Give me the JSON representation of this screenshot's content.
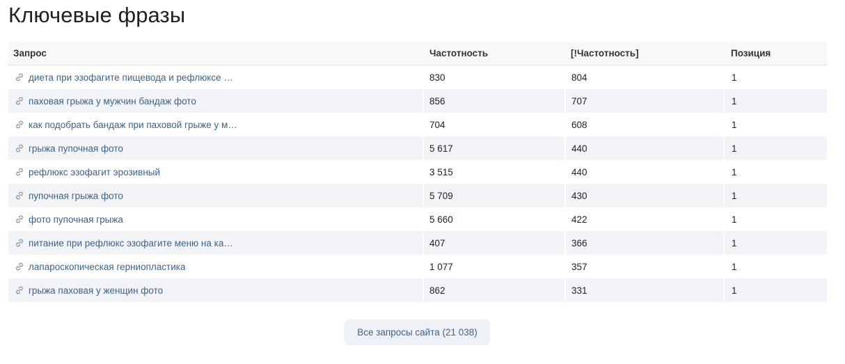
{
  "page": {
    "title": "Ключевые фразы"
  },
  "table": {
    "headers": {
      "query": "Запрос",
      "frequency": "Частотность",
      "exact_frequency": "[!Частотность]",
      "position": "Позиция"
    },
    "rows": [
      {
        "query": "диета при эзофагите пищевода и рефлюксе ре…",
        "frequency": "830",
        "exact_frequency": "804",
        "position": "1"
      },
      {
        "query": "паховая грыжа у мужчин бандаж фото",
        "frequency": "856",
        "exact_frequency": "707",
        "position": "1"
      },
      {
        "query": "как подобрать бандаж при паховой грыже у му…",
        "frequency": "704",
        "exact_frequency": "608",
        "position": "1"
      },
      {
        "query": "грыжа пупочная фото",
        "frequency": "5 617",
        "exact_frequency": "440",
        "position": "1"
      },
      {
        "query": "рефлюкс эзофагит эрозивный",
        "frequency": "3 515",
        "exact_frequency": "440",
        "position": "1"
      },
      {
        "query": "пупочная грыжа фото",
        "frequency": "5 709",
        "exact_frequency": "430",
        "position": "1"
      },
      {
        "query": "фото пупочная грыжа",
        "frequency": "5 660",
        "exact_frequency": "422",
        "position": "1"
      },
      {
        "query": "питание при рефлюкс эзофагите меню на кажд…",
        "frequency": "407",
        "exact_frequency": "366",
        "position": "1"
      },
      {
        "query": "лапароскопическая герниопластика",
        "frequency": "1 077",
        "exact_frequency": "357",
        "position": "1"
      },
      {
        "query": "грыжа паховая у женщин фото",
        "frequency": "862",
        "exact_frequency": "331",
        "position": "1"
      }
    ],
    "row_icon": "link-icon"
  },
  "footer": {
    "all_queries_label": "Все запросы сайта (21 038)"
  },
  "colors": {
    "link": "#3b6391",
    "header_bg": "#f7f8fa",
    "stripe_bg": "#f2f4f7",
    "button_bg": "#eef1f5"
  }
}
